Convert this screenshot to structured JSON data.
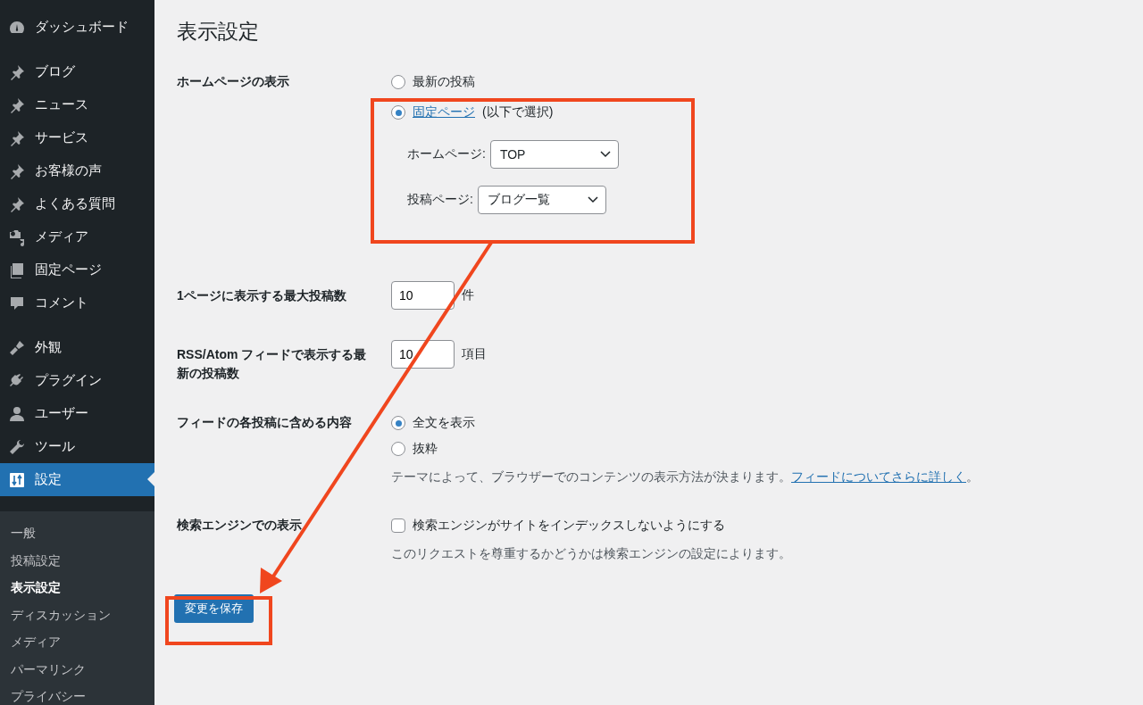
{
  "sidebar": {
    "menu_groups": [
      {
        "items": [
          {
            "label": "ダッシュボード",
            "kind": "gauge",
            "selected": false
          }
        ]
      },
      {
        "items": [
          {
            "label": "ブログ",
            "kind": "pin",
            "selected": false
          },
          {
            "label": "ニュース",
            "kind": "pin",
            "selected": false
          },
          {
            "label": "サービス",
            "kind": "pin",
            "selected": false
          },
          {
            "label": "お客様の声",
            "kind": "pin",
            "selected": false
          },
          {
            "label": "よくある質問",
            "kind": "pin",
            "selected": false
          },
          {
            "label": "メディア",
            "kind": "media",
            "selected": false
          },
          {
            "label": "固定ページ",
            "kind": "pages",
            "selected": false
          },
          {
            "label": "コメント",
            "kind": "comment",
            "selected": false
          }
        ]
      },
      {
        "items": [
          {
            "label": "外観",
            "kind": "brush",
            "selected": false
          },
          {
            "label": "プラグイン",
            "kind": "plug",
            "selected": false
          },
          {
            "label": "ユーザー",
            "kind": "user",
            "selected": false
          },
          {
            "label": "ツール",
            "kind": "wrench",
            "selected": false
          },
          {
            "label": "設定",
            "kind": "sliders",
            "selected": true
          }
        ]
      }
    ],
    "submenu": [
      {
        "label": "一般",
        "selected": false
      },
      {
        "label": "投稿設定",
        "selected": false
      },
      {
        "label": "表示設定",
        "selected": true
      },
      {
        "label": "ディスカッション",
        "selected": false
      },
      {
        "label": "メディア",
        "selected": false
      },
      {
        "label": "パーマリンク",
        "selected": false
      },
      {
        "label": "プライバシー",
        "selected": false
      }
    ]
  },
  "title": "表示設定",
  "rows": [
    {
      "kind": "homepage",
      "label": "ホームページの表示",
      "options": [
        {
          "kind": "plain",
          "text": "最新の投稿",
          "selected": false
        },
        {
          "kind": "link",
          "link": "固定ページ",
          "suffix": "(以下で選択)",
          "selected": true
        }
      ],
      "selects": [
        {
          "label": "ホームページ:",
          "value": "TOP"
        },
        {
          "label": "投稿ページ:",
          "value": "ブログ一覧"
        }
      ]
    },
    {
      "kind": "number",
      "label": "1ページに表示する最大投稿数",
      "value": "10",
      "unit": "件"
    },
    {
      "kind": "number",
      "label": "RSS/Atom フィードで表示する最新の投稿数",
      "value": "10",
      "unit": "項目"
    },
    {
      "kind": "radios",
      "label": "フィードの各投稿に含める内容",
      "options": [
        {
          "text": "全文を表示",
          "selected": true
        },
        {
          "text": "抜粋",
          "selected": false
        }
      ],
      "note": "テーマによって、ブラウザーでのコンテンツの表示方法が決まります。",
      "note_link": "フィードについてさらに詳しく",
      "note_end": "。"
    },
    {
      "kind": "checkbox",
      "label": "検索エンジンでの表示",
      "text": "検索エンジンがサイトをインデックスしないようにする",
      "checked": false,
      "note": "このリクエストを尊重するかどうかは検索エンジンの設定によります。"
    }
  ],
  "save_button": "変更を保存"
}
